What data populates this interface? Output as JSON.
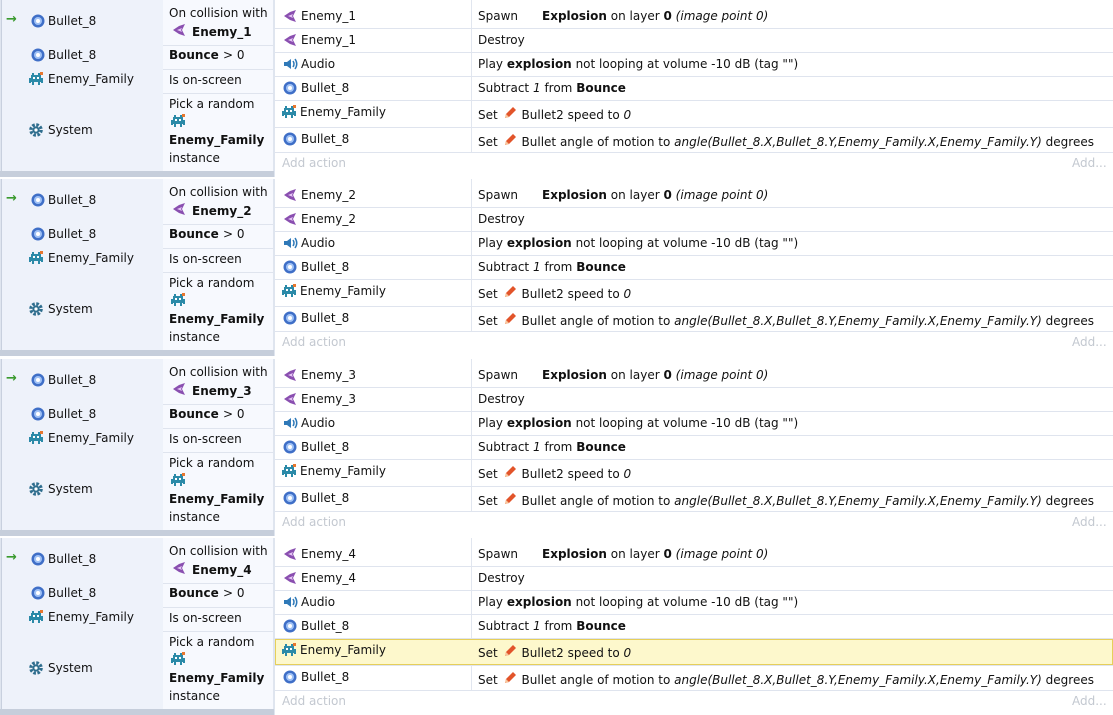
{
  "events": [
    {
      "enemy": "Enemy_1",
      "cond_objects": [
        "Bullet_8",
        "Bullet_8",
        "Enemy_Family",
        "System"
      ],
      "conditions": {
        "on_collision": "On collision with",
        "collision_target": "Enemy_1",
        "bounce_label": "Bounce",
        "bounce_cmp": "> 0",
        "onscreen": "Is on-screen",
        "pick_random": "Pick a random",
        "pick_family": "Enemy_Family",
        "pick_instance": "instance"
      },
      "actions": [
        {
          "obj": "Enemy_1",
          "parts": [
            [
              "",
              "Spawn"
            ],
            [
              "b",
              "Explosion"
            ],
            [
              "",
              "on layer"
            ],
            [
              "b",
              "0"
            ],
            [
              "i",
              "(image point 0)"
            ]
          ]
        },
        {
          "obj": "Enemy_1",
          "parts": [
            [
              "",
              "Destroy"
            ]
          ]
        },
        {
          "obj": "Audio",
          "parts": [
            [
              "",
              "Play"
            ],
            [
              "b",
              "explosion"
            ],
            [
              "",
              "not looping at volume -10 dB (tag \"\")"
            ]
          ]
        },
        {
          "obj": "Bullet_8",
          "parts": [
            [
              "",
              "Subtract"
            ],
            [
              "i",
              "1"
            ],
            [
              "",
              "from"
            ],
            [
              "b",
              "Bounce"
            ]
          ]
        },
        {
          "obj": "Enemy_Family",
          "parts": [
            [
              "",
              "Set"
            ],
            [
              "pen",
              ""
            ],
            [
              "",
              "Bullet2 speed to"
            ],
            [
              "i",
              "0"
            ]
          ]
        },
        {
          "obj": "Bullet_8",
          "parts": [
            [
              "",
              "Set"
            ],
            [
              "pen",
              ""
            ],
            [
              "",
              "Bullet angle of motion to"
            ],
            [
              "i",
              "angle(Bullet_8.X,Bullet_8.Y,Enemy_Family.X,Enemy_Family.Y)"
            ],
            [
              "",
              "degrees"
            ]
          ]
        }
      ]
    },
    {
      "enemy": "Enemy_2",
      "cond_objects": [
        "Bullet_8",
        "Bullet_8",
        "Enemy_Family",
        "System"
      ],
      "conditions": {
        "on_collision": "On collision with",
        "collision_target": "Enemy_2",
        "bounce_label": "Bounce",
        "bounce_cmp": "> 0",
        "onscreen": "Is on-screen",
        "pick_random": "Pick a random",
        "pick_family": "Enemy_Family",
        "pick_instance": "instance"
      },
      "actions": [
        {
          "obj": "Enemy_2",
          "parts": [
            [
              "",
              "Spawn"
            ],
            [
              "b",
              "Explosion"
            ],
            [
              "",
              "on layer"
            ],
            [
              "b",
              "0"
            ],
            [
              "i",
              "(image point 0)"
            ]
          ]
        },
        {
          "obj": "Enemy_2",
          "parts": [
            [
              "",
              "Destroy"
            ]
          ]
        },
        {
          "obj": "Audio",
          "parts": [
            [
              "",
              "Play"
            ],
            [
              "b",
              "explosion"
            ],
            [
              "",
              "not looping at volume -10 dB (tag \"\")"
            ]
          ]
        },
        {
          "obj": "Bullet_8",
          "parts": [
            [
              "",
              "Subtract"
            ],
            [
              "i",
              "1"
            ],
            [
              "",
              "from"
            ],
            [
              "b",
              "Bounce"
            ]
          ]
        },
        {
          "obj": "Enemy_Family",
          "parts": [
            [
              "",
              "Set"
            ],
            [
              "pen",
              ""
            ],
            [
              "",
              "Bullet2 speed to"
            ],
            [
              "i",
              "0"
            ]
          ]
        },
        {
          "obj": "Bullet_8",
          "parts": [
            [
              "",
              "Set"
            ],
            [
              "pen",
              ""
            ],
            [
              "",
              "Bullet angle of motion to"
            ],
            [
              "i",
              "angle(Bullet_8.X,Bullet_8.Y,Enemy_Family.X,Enemy_Family.Y)"
            ],
            [
              "",
              "degrees"
            ]
          ]
        }
      ]
    },
    {
      "enemy": "Enemy_3",
      "cond_objects": [
        "Bullet_8",
        "Bullet_8",
        "Enemy_Family",
        "System"
      ],
      "conditions": {
        "on_collision": "On collision with",
        "collision_target": "Enemy_3",
        "bounce_label": "Bounce",
        "bounce_cmp": "> 0",
        "onscreen": "Is on-screen",
        "pick_random": "Pick a random",
        "pick_family": "Enemy_Family",
        "pick_instance": "instance"
      },
      "actions": [
        {
          "obj": "Enemy_3",
          "parts": [
            [
              "",
              "Spawn"
            ],
            [
              "b",
              "Explosion"
            ],
            [
              "",
              "on layer"
            ],
            [
              "b",
              "0"
            ],
            [
              "i",
              "(image point 0)"
            ]
          ]
        },
        {
          "obj": "Enemy_3",
          "parts": [
            [
              "",
              "Destroy"
            ]
          ]
        },
        {
          "obj": "Audio",
          "parts": [
            [
              "",
              "Play"
            ],
            [
              "b",
              "explosion"
            ],
            [
              "",
              "not looping at volume -10 dB (tag \"\")"
            ]
          ]
        },
        {
          "obj": "Bullet_8",
          "parts": [
            [
              "",
              "Subtract"
            ],
            [
              "i",
              "1"
            ],
            [
              "",
              "from"
            ],
            [
              "b",
              "Bounce"
            ]
          ]
        },
        {
          "obj": "Enemy_Family",
          "parts": [
            [
              "",
              "Set"
            ],
            [
              "pen",
              ""
            ],
            [
              "",
              "Bullet2 speed to"
            ],
            [
              "i",
              "0"
            ]
          ]
        },
        {
          "obj": "Bullet_8",
          "parts": [
            [
              "",
              "Set"
            ],
            [
              "pen",
              ""
            ],
            [
              "",
              "Bullet angle of motion to"
            ],
            [
              "i",
              "angle(Bullet_8.X,Bullet_8.Y,Enemy_Family.X,Enemy_Family.Y)"
            ],
            [
              "",
              "degrees"
            ]
          ]
        }
      ]
    },
    {
      "enemy": "Enemy_4",
      "cond_objects": [
        "Bullet_8",
        "Bullet_8",
        "Enemy_Family",
        "System"
      ],
      "conditions": {
        "on_collision": "On collision with",
        "collision_target": "Enemy_4",
        "bounce_label": "Bounce",
        "bounce_cmp": "> 0",
        "onscreen": "Is on-screen",
        "pick_random": "Pick a random",
        "pick_family": "Enemy_Family",
        "pick_instance": "instance"
      },
      "actions": [
        {
          "obj": "Enemy_4",
          "parts": [
            [
              "",
              "Spawn"
            ],
            [
              "b",
              "Explosion"
            ],
            [
              "",
              "on layer"
            ],
            [
              "b",
              "0"
            ],
            [
              "i",
              "(image point 0)"
            ]
          ]
        },
        {
          "obj": "Enemy_4",
          "parts": [
            [
              "",
              "Destroy"
            ]
          ]
        },
        {
          "obj": "Audio",
          "parts": [
            [
              "",
              "Play"
            ],
            [
              "b",
              "explosion"
            ],
            [
              "",
              "not looping at volume -10 dB (tag \"\")"
            ]
          ]
        },
        {
          "obj": "Bullet_8",
          "parts": [
            [
              "",
              "Subtract"
            ],
            [
              "i",
              "1"
            ],
            [
              "",
              "from"
            ],
            [
              "b",
              "Bounce"
            ]
          ]
        },
        {
          "obj": "Enemy_Family",
          "parts": [
            [
              "",
              "Set"
            ],
            [
              "pen",
              ""
            ],
            [
              "",
              "Bullet2 speed to"
            ],
            [
              "i",
              "0"
            ]
          ],
          "selected": true
        },
        {
          "obj": "Bullet_8",
          "parts": [
            [
              "",
              "Set"
            ],
            [
              "pen",
              ""
            ],
            [
              "",
              "Bullet angle of motion to"
            ],
            [
              "i",
              "angle(Bullet_8.X,Bullet_8.Y,Enemy_Family.X,Enemy_Family.Y)"
            ],
            [
              "",
              "degrees"
            ]
          ]
        }
      ]
    }
  ],
  "add_action": "Add action",
  "add_more": "Add...",
  "colors": {
    "selected_row_bg": "#fdf8cc",
    "selected_row_border": "#e6cf5a",
    "trigger_arrow": "#3a9a2e",
    "muted_text": "#c3c8d0"
  },
  "icons": {
    "trigger": "green-arrow-icon",
    "bullet": "bullet-orb-icon",
    "family": "space-invader-icon",
    "system": "gear-icon",
    "audio": "speaker-icon",
    "enemy": "ship-icon",
    "pen": "pencil-icon"
  }
}
